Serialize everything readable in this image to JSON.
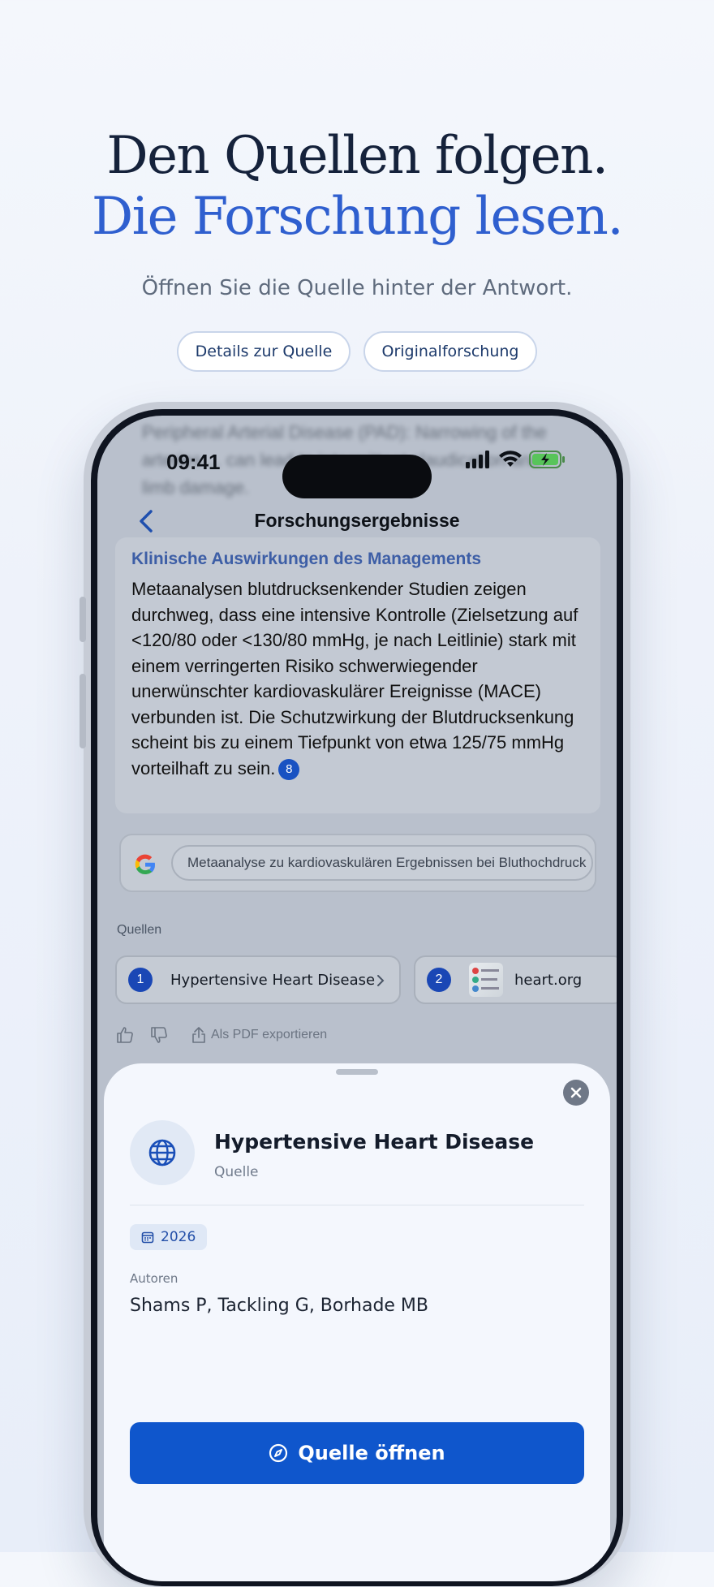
{
  "hero": {
    "line1": "Den Quellen folgen.",
    "line2": "Die Forschung lesen.",
    "subtitle": "Öffnen Sie die Quelle hinter der Antwort."
  },
  "pills": [
    "Details zur Quelle",
    "Originalforschung"
  ],
  "phone": {
    "time": "09:41",
    "background_text": "Peripheral Arterial Disease (PAD): Narrowing of the arteries ... can lead to intermittent claudication and limb damage.",
    "nav_title": "Forschungsergebnisse",
    "card": {
      "heading": "Klinische Auswirkungen des Managements",
      "body": "Metaanalysen blutdrucksenkender Studien zeigen durchweg, dass eine intensive Kontrolle (Zielsetzung auf <120/80 oder <130/80 mmHg, je nach Leitlinie) stark mit einem verringerten Risiko schwerwiegender unerwünschter kardiovaskulärer Ereignisse (MACE) verbunden ist. Die Schutzwirkung der Blutdrucksenkung scheint bis zu einem Tiefpunkt von etwa 125/75 mmHg vorteilhaft zu sein.",
      "citation": "8"
    },
    "search_query": "Metaanalyse zu kardiovaskulären Ergebnissen bei Bluthochdruck",
    "sources_label": "Quellen",
    "sources": [
      {
        "num": "1",
        "label": "Hypertensive Heart Disease"
      },
      {
        "num": "2",
        "label": "heart.org"
      }
    ],
    "export_label": "Als PDF exportieren",
    "sheet": {
      "title": "Hypertensive Heart Disease",
      "subtitle": "Quelle",
      "year": "2026",
      "authors_label": "Autoren",
      "authors": "Shams P, Tackling G, Borhade MB",
      "open_button": "Quelle öffnen"
    }
  },
  "colors": {
    "accent": "#0f56cc",
    "hero_dark": "#15223b",
    "hero_blue": "#2f5fcf"
  }
}
